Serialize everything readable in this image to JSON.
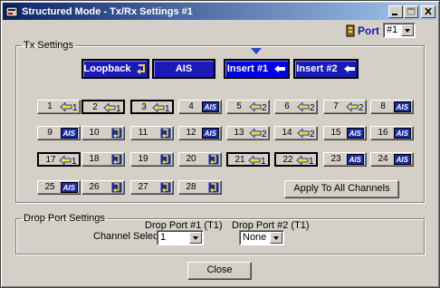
{
  "window": {
    "title": "Structured Mode - Tx/Rx Settings #1"
  },
  "port": {
    "label": "Port",
    "value": "#1"
  },
  "tx": {
    "legend": "Tx Settings",
    "modes": [
      "Loopback",
      "AIS",
      "Insert #1",
      "Insert #2"
    ],
    "channels": [
      {
        "n": "1",
        "k": "a1",
        "act": false
      },
      {
        "n": "2",
        "k": "a1",
        "act": true
      },
      {
        "n": "3",
        "k": "a1",
        "act": true
      },
      {
        "n": "4",
        "k": "ais",
        "act": false
      },
      {
        "n": "5",
        "k": "a2",
        "act": false
      },
      {
        "n": "6",
        "k": "a2",
        "act": false
      },
      {
        "n": "7",
        "k": "a2",
        "act": false
      },
      {
        "n": "8",
        "k": "ais",
        "act": false
      },
      {
        "n": "9",
        "k": "ais",
        "act": false
      },
      {
        "n": "10",
        "k": "lb",
        "act": false
      },
      {
        "n": "11",
        "k": "lb",
        "act": false
      },
      {
        "n": "12",
        "k": "ais",
        "act": false
      },
      {
        "n": "13",
        "k": "a2",
        "act": false
      },
      {
        "n": "14",
        "k": "a2",
        "act": false
      },
      {
        "n": "15",
        "k": "ais",
        "act": false
      },
      {
        "n": "16",
        "k": "ais",
        "act": false
      },
      {
        "n": "17",
        "k": "a1",
        "act": true
      },
      {
        "n": "18",
        "k": "lb",
        "act": false
      },
      {
        "n": "19",
        "k": "lb",
        "act": false
      },
      {
        "n": "20",
        "k": "lb",
        "act": false
      },
      {
        "n": "21",
        "k": "a1",
        "act": true
      },
      {
        "n": "22",
        "k": "a1",
        "act": true
      },
      {
        "n": "23",
        "k": "ais",
        "act": false
      },
      {
        "n": "24",
        "k": "ais",
        "act": false
      },
      {
        "n": "25",
        "k": "ais",
        "act": false
      },
      {
        "n": "26",
        "k": "lb",
        "act": false
      },
      {
        "n": "27",
        "k": "lb",
        "act": false
      },
      {
        "n": "28",
        "k": "lb",
        "act": false
      }
    ],
    "apply_label": "Apply To All Channels"
  },
  "drop": {
    "legend": "Drop Port Settings",
    "channel_selection_label": "Channel Selection",
    "port1": {
      "label": "Drop Port #1 (T1)",
      "value": "1"
    },
    "port2": {
      "label": "Drop Port #2 (T1)",
      "value": "None"
    }
  },
  "close_label": "Close",
  "colors": {
    "title_start": "#0a246a",
    "title_end": "#a6caf0",
    "mode_button": "#1a1ab8",
    "ais_badge": "#1a2aa0",
    "arrow_yellow": "#f0e020"
  }
}
